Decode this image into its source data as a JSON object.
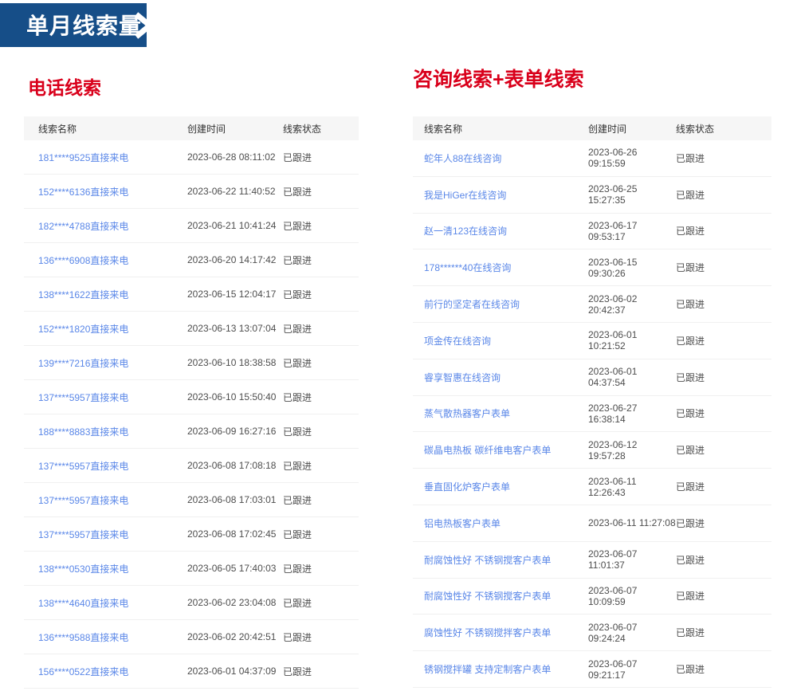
{
  "banner": {
    "title": "单月线索量",
    "bg_color": "#164e88",
    "chevron_icon": "chevron-right"
  },
  "colors": {
    "banner_blue": "#164e88",
    "title_red": "#d9001b",
    "link_blue": "#5a87e8",
    "body_text": "#4d4d4d",
    "header_bg": "#f6f6f6",
    "divider": "#f0f0f0"
  },
  "left_table": {
    "title": "电话线索",
    "columns": [
      "线索名称",
      "创建时间",
      "线索状态"
    ],
    "rows": [
      {
        "name": "181****9525直接来电",
        "time": "2023-06-28 08:11:02",
        "status": "已跟进"
      },
      {
        "name": "152****6136直接来电",
        "time": "2023-06-22 11:40:52",
        "status": "已跟进"
      },
      {
        "name": "182****4788直接来电",
        "time": "2023-06-21 10:41:24",
        "status": "已跟进"
      },
      {
        "name": "136****6908直接来电",
        "time": "2023-06-20 14:17:42",
        "status": "已跟进"
      },
      {
        "name": "138****1622直接来电",
        "time": "2023-06-15 12:04:17",
        "status": "已跟进"
      },
      {
        "name": "152****1820直接来电",
        "time": "2023-06-13 13:07:04",
        "status": "已跟进"
      },
      {
        "name": "139****7216直接来电",
        "time": "2023-06-10 18:38:58",
        "status": "已跟进"
      },
      {
        "name": "137****5957直接来电",
        "time": "2023-06-10 15:50:40",
        "status": "已跟进"
      },
      {
        "name": "188****8883直接来电",
        "time": "2023-06-09 16:27:16",
        "status": "已跟进"
      },
      {
        "name": "137****5957直接来电",
        "time": "2023-06-08 17:08:18",
        "status": "已跟进"
      },
      {
        "name": "137****5957直接来电",
        "time": "2023-06-08 17:03:01",
        "status": "已跟进"
      },
      {
        "name": "137****5957直接来电",
        "time": "2023-06-08 17:02:45",
        "status": "已跟进"
      },
      {
        "name": "138****0530直接来电",
        "time": "2023-06-05 17:40:03",
        "status": "已跟进"
      },
      {
        "name": "138****4640直接来电",
        "time": "2023-06-02 23:04:08",
        "status": "已跟进"
      },
      {
        "name": "136****9588直接来电",
        "time": "2023-06-02 20:42:51",
        "status": "已跟进"
      },
      {
        "name": "156****0522直接来电",
        "time": "2023-06-01 04:37:09",
        "status": "已跟进"
      }
    ]
  },
  "right_table": {
    "title": "咨询线索+表单线索",
    "columns": [
      "线索名称",
      "创建时间",
      "线索状态"
    ],
    "rows": [
      {
        "name": "蛇年人88在线咨询",
        "time": "2023-06-26 09:15:59",
        "status": "已跟进"
      },
      {
        "name": "我是HiGer在线咨询",
        "time": "2023-06-25 15:27:35",
        "status": "已跟进"
      },
      {
        "name": "赵一清123在线咨询",
        "time": "2023-06-17 09:53:17",
        "status": "已跟进"
      },
      {
        "name": "178******40在线咨询",
        "time": "2023-06-15 09:30:26",
        "status": "已跟进"
      },
      {
        "name": "前行的坚定者在线咨询",
        "time": "2023-06-02 20:42:37",
        "status": "已跟进"
      },
      {
        "name": "项金传在线咨询",
        "time": "2023-06-01 10:21:52",
        "status": "已跟进"
      },
      {
        "name": "睿享智惠在线咨询",
        "time": "2023-06-01 04:37:54",
        "status": "已跟进"
      },
      {
        "name": "蒸气散热器客户表单",
        "time": "2023-06-27 16:38:14",
        "status": "已跟进"
      },
      {
        "name": "碳晶电热板 碳纤维电客户表单",
        "time": "2023-06-12 19:57:28",
        "status": "已跟进"
      },
      {
        "name": "垂直固化炉客户表单",
        "time": "2023-06-11 12:26:43",
        "status": "已跟进"
      },
      {
        "name": "铝电热板客户表单",
        "time": "2023-06-11 11:27:08",
        "status": "已跟进"
      },
      {
        "name": "耐腐蚀性好 不锈钢搅客户表单",
        "time": "2023-06-07 11:01:37",
        "status": "已跟进"
      },
      {
        "name": "耐腐蚀性好 不锈钢搅客户表单",
        "time": "2023-06-07 10:09:59",
        "status": "已跟进"
      },
      {
        "name": "腐蚀性好 不锈钢搅拌客户表单",
        "time": "2023-06-07 09:24:24",
        "status": "已跟进"
      },
      {
        "name": "锈钢搅拌罐 支持定制客户表单",
        "time": "2023-06-07 09:21:17",
        "status": "已跟进"
      }
    ]
  }
}
